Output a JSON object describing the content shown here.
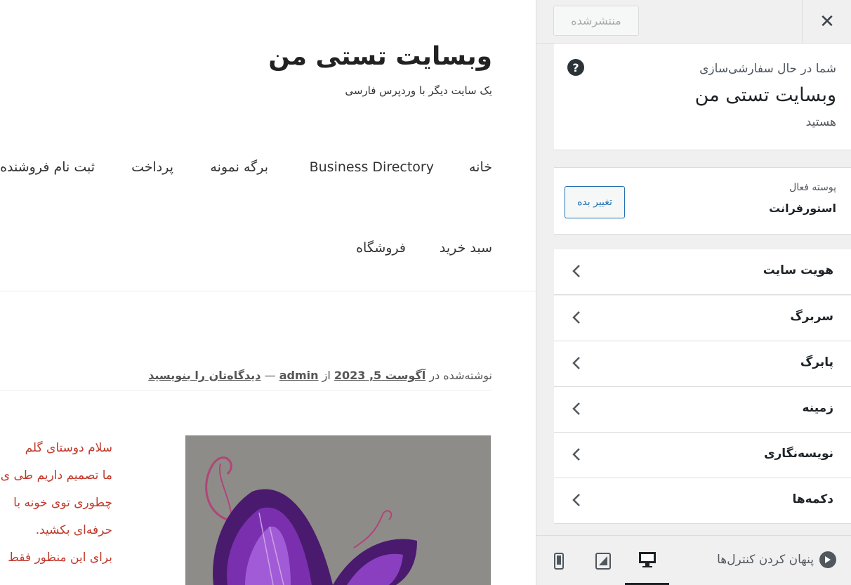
{
  "site": {
    "title": "وبسایت تستی من",
    "tagline": "یک سایت دیگر با وردپرس فارسی"
  },
  "nav": {
    "row1": [
      "خانه",
      "Business Directory",
      "برگه نمونه",
      "پرداخت",
      "ثبت نام فروشنده"
    ],
    "row2": [
      "سبد خرید",
      "فروشگاه"
    ]
  },
  "post": {
    "meta_posted_in": "نوشته‌شده در",
    "meta_date": "آگوست 5, 2023",
    "meta_from": "از",
    "meta_author": "admin",
    "meta_sep": "—",
    "meta_comment": "دیدگاه‌تان را بنویسید",
    "lines": [
      "سلام دوستای گلم",
      "ما تصمیم داریم طی ی",
      "چطوری توی خونه با",
      "حرفه‌ای بکشید.",
      "برای این منظور فقط"
    ],
    "image_icon": "butterfly-illustration"
  },
  "sidebar": {
    "publish_label": "منتشرشده",
    "close_icon": "close-icon",
    "info": {
      "pre": "شما در حال سفارشی‌سازی",
      "title": "وبسایت تستی من",
      "post": "هستید",
      "help_glyph": "?"
    },
    "theme": {
      "label": "پوسته فعال",
      "name": "استورفرانت",
      "change_label": "تغییر بده"
    },
    "sections": [
      "هویت سایت",
      "سربرگ",
      "پابرگ",
      "زمینه",
      "نویسه‌نگاری",
      "دکمه‌ها"
    ]
  },
  "footer": {
    "hide_controls_label": "پنهان کردن کنترل‌ها",
    "devices": [
      "mobile-icon",
      "tablet-icon",
      "desktop-icon"
    ],
    "active_device": "desktop"
  },
  "colors": {
    "accent": "#2271b1",
    "post_text": "#c0392b",
    "sidebar_bg": "#f0f0f1"
  }
}
